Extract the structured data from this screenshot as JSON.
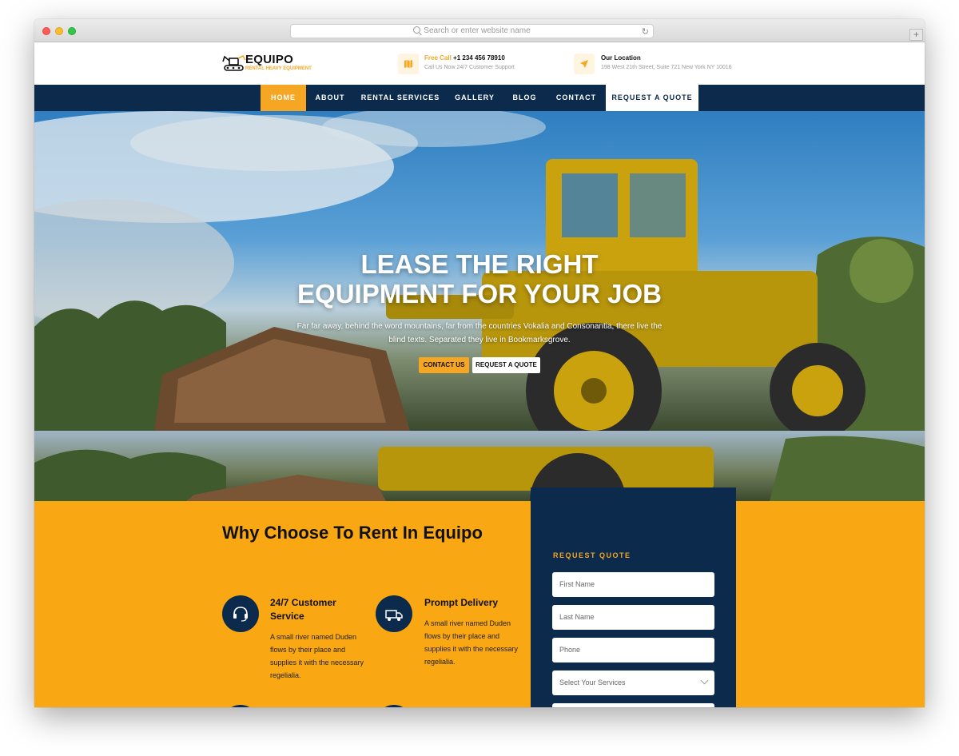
{
  "browser": {
    "address_placeholder": "Search or enter website name",
    "newtab_label": "+"
  },
  "header": {
    "logo_name": "EQUIPO",
    "logo_tagline": "RENTAL HEAVY EQUIPMENT",
    "call_label": "Free Call",
    "call_number": "+1 234 456 78910",
    "call_sub": "Call Us Now 24/7 Customer Support",
    "location_title": "Our Location",
    "location_sub": "198 West 21th Street, Suite 721 New York NY 10016"
  },
  "nav": {
    "items": [
      "HOME",
      "ABOUT",
      "RENTAL SERVICES",
      "GALLERY",
      "BLOG",
      "CONTACT"
    ],
    "quote": "REQUEST A QUOTE",
    "active": "HOME"
  },
  "hero": {
    "title_line1": "LEASE THE RIGHT",
    "title_line2": "EQUIPMENT FOR YOUR JOB",
    "subtitle": "Far far away, behind the word mountains, far from the countries Vokalia and Consonantia, there live the blind texts. Separated they live in Bookmarksgrove.",
    "btn_contact": "CONTACT US",
    "btn_quote": "REQUEST A QUOTE"
  },
  "why": {
    "title": "Why Choose To Rent In Equipo",
    "features": [
      {
        "title": "24/7 Customer Service",
        "text": "A small river named Duden flows by their place and supplies it with the necessary regelialia.",
        "icon": "support-icon"
      },
      {
        "title": "Prompt Delivery",
        "text": "A small river named Duden flows by their place and supplies it with the necessary regelialia.",
        "icon": "delivery-icon"
      }
    ]
  },
  "quote_form": {
    "heading": "REQUEST QUOTE",
    "first_name": "First Name",
    "last_name": "Last Name",
    "phone": "Phone",
    "service_select": "Select Your Services"
  },
  "colors": {
    "accent": "#f5a623",
    "navy": "#0b2a4c",
    "section_bg": "#f9a713"
  }
}
